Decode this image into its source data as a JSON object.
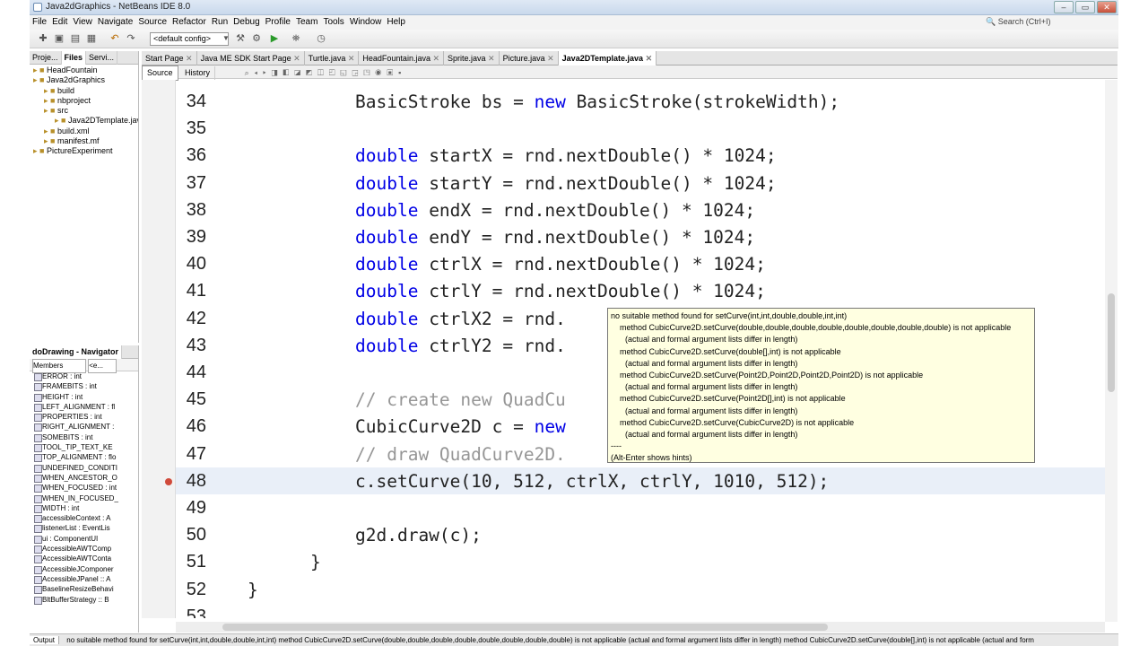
{
  "window": {
    "title": "Java2dGraphics - NetBeans IDE 8.0"
  },
  "menu": [
    "File",
    "Edit",
    "View",
    "Navigate",
    "Source",
    "Refactor",
    "Run",
    "Debug",
    "Profile",
    "Team",
    "Tools",
    "Window",
    "Help"
  ],
  "search": {
    "placeholder": "Search (Ctrl+I)"
  },
  "toolbar": {
    "config": "<default config>"
  },
  "projects": {
    "tabs": [
      "Proje...",
      "Files",
      "Servi..."
    ],
    "tree": [
      {
        "label": "HeadFountain",
        "indent": 0
      },
      {
        "label": "Java2dGraphics",
        "indent": 0
      },
      {
        "label": "build",
        "indent": 1
      },
      {
        "label": "nbproject",
        "indent": 1
      },
      {
        "label": "src",
        "indent": 1
      },
      {
        "label": "Java2DTemplate.java",
        "indent": 2
      },
      {
        "label": "build.xml",
        "indent": 1
      },
      {
        "label": "manifest.mf",
        "indent": 1
      },
      {
        "label": "PictureExperiment",
        "indent": 0
      }
    ]
  },
  "navigator": {
    "title": "doDrawing - Navigator",
    "filter": "Members",
    "filter2": "<e...",
    "items": [
      "ERROR : int",
      "FRAMEBITS : int",
      "HEIGHT : int",
      "LEFT_ALIGNMENT : fl",
      "PROPERTIES : int",
      "RIGHT_ALIGNMENT :",
      "SOMEBITS : int",
      "TOOL_TIP_TEXT_KE",
      "TOP_ALIGNMENT : flo",
      "UNDEFINED_CONDITI",
      "WHEN_ANCESTOR_O",
      "WHEN_FOCUSED : int",
      "WHEN_IN_FOCUSED_",
      "WIDTH : int",
      "accessibleContext : A",
      "listenerList : EventLis",
      "ui : ComponentUI",
      "AccessibleAWTComp",
      "AccessibleAWTConta",
      "AccessibleJComponer",
      "AccessibleJPanel :: A",
      "BaselineResizeBehavi",
      "BltBufferStrategy :: B"
    ]
  },
  "editor": {
    "tabs": [
      "Start Page",
      "Java ME SDK Start Page",
      "Turtle.java",
      "HeadFountain.java",
      "Sprite.java",
      "Picture.java",
      "Java2DTemplate.java"
    ],
    "selected_tab": "Java2DTemplate.java",
    "views": [
      "Source",
      "History"
    ],
    "lines": [
      {
        "n": "34",
        "text": "BasicStroke bs = new BasicStroke(strokeWidth);"
      },
      {
        "n": "35",
        "text": ""
      },
      {
        "n": "36",
        "text": "double startX = rnd.nextDouble() * 1024;"
      },
      {
        "n": "37",
        "text": "double startY = rnd.nextDouble() * 1024;"
      },
      {
        "n": "38",
        "text": "double endX = rnd.nextDouble() * 1024;"
      },
      {
        "n": "39",
        "text": "double endY = rnd.nextDouble() * 1024;"
      },
      {
        "n": "40",
        "text": "double ctrlX = rnd.nextDouble() * 1024;"
      },
      {
        "n": "41",
        "text": "double ctrlY = rnd.nextDouble() * 1024;"
      },
      {
        "n": "42",
        "text": "double ctrlX2 = rnd."
      },
      {
        "n": "43",
        "text": "double ctrlY2 = rnd."
      },
      {
        "n": "44",
        "text": ""
      },
      {
        "n": "45",
        "text": "// create new QuadCu"
      },
      {
        "n": "46",
        "text": "CubicCurve2D c = new"
      },
      {
        "n": "47",
        "text": "// draw QuadCurve2D."
      },
      {
        "n": "48",
        "text": "c.setCurve(10, 512, ctrlX, ctrlY, 1010, 512);"
      },
      {
        "n": "49",
        "text": ""
      },
      {
        "n": "50",
        "text": "g2d.draw(c);"
      },
      {
        "n": "51",
        "text": "}"
      },
      {
        "n": "52",
        "text": "}"
      },
      {
        "n": "53",
        "text": ""
      }
    ]
  },
  "tooltip": {
    "lines": [
      "no suitable method found for setCurve(int,int,double,double,int,int)",
      "method CubicCurve2D.setCurve(double,double,double,double,double,double,double,double) is not applicable",
      "(actual and formal argument lists differ in length)",
      "method CubicCurve2D.setCurve(double[],int) is not applicable",
      "(actual and formal argument lists differ in length)",
      "method CubicCurve2D.setCurve(Point2D,Point2D,Point2D,Point2D) is not applicable",
      "(actual and formal argument lists differ in length)",
      "method CubicCurve2D.setCurve(Point2D[],int) is not applicable",
      "(actual and formal argument lists differ in length)",
      "method CubicCurve2D.setCurve(CubicCurve2D) is not applicable",
      "(actual and formal argument lists differ in length)",
      "----",
      "(Alt-Enter shows hints)"
    ]
  },
  "status": {
    "output_label": "Output",
    "message": "no suitable method found for setCurve(int,int,double,double,int,int)    method CubicCurve2D.setCurve(double,double,double,double,double,double,double,double) is not applicable    (actual and formal argument lists differ in length)    method CubicCurve2D.setCurve(double[],int) is not applicable    (actual and form"
  }
}
